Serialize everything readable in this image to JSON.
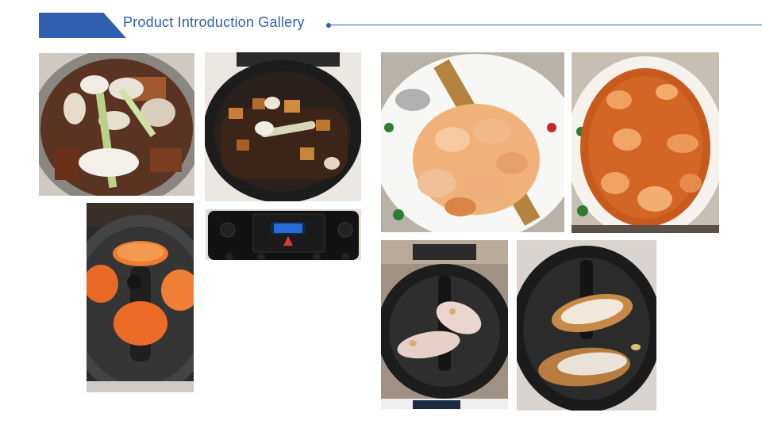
{
  "slide": {
    "title": "Product Introduction  Gallery",
    "accent_color": "#2f5fae"
  },
  "photos": [
    {
      "name": "garlic-pork-pot-photo",
      "depicts": "pot of pork with garlic and scallion"
    },
    {
      "name": "braised-pork-cooker-photo",
      "depicts": "braised pork in cooker"
    },
    {
      "name": "control-panel-photo",
      "depicts": "cooker control panel"
    },
    {
      "name": "fried-fish-cakes-photo",
      "depicts": "pan-fried fish cakes in cooker"
    },
    {
      "name": "shrimp-plate-photo",
      "depicts": "plate of prawns with wooden spatula"
    },
    {
      "name": "shrimp-sauce-plate-photo",
      "depicts": "prawns in tomato sauce"
    },
    {
      "name": "raw-fish-cooker-photo",
      "depicts": "raw fish steaks in cooker"
    },
    {
      "name": "cooked-fish-cooker-photo",
      "depicts": "cooked fish steaks in cooker"
    }
  ]
}
